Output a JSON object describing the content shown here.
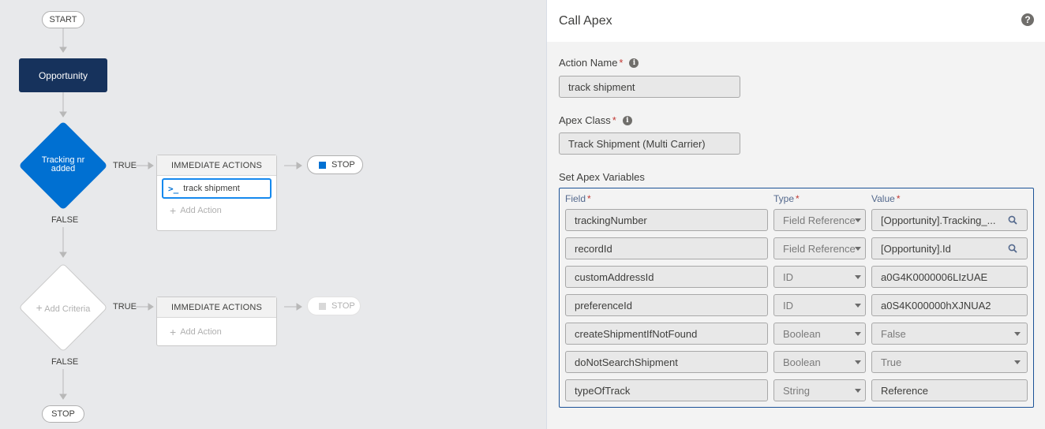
{
  "canvas": {
    "start_label": "START",
    "object_label": "Opportunity",
    "criteria_label": "Tracking nr added",
    "true_label": "TRUE",
    "false_label": "FALSE",
    "immediate_actions_label": "IMMEDIATE ACTIONS",
    "action_item_label": "track shipment",
    "add_action_label": "Add Action",
    "stop_label": "STOP",
    "add_criteria_label": "Add Criteria",
    "end_stop_label": "STOP"
  },
  "panel": {
    "title": "Call Apex",
    "action_name_label": "Action Name",
    "action_name_value": "track shipment",
    "apex_class_label": "Apex Class",
    "apex_class_value": "Track Shipment (Multi Carrier)",
    "set_vars_label": "Set Apex Variables",
    "columns": {
      "field": "Field",
      "type": "Type",
      "value": "Value"
    },
    "rows": [
      {
        "field": "trackingNumber",
        "type": "Field Reference",
        "value": "[Opportunity].Tracking_...",
        "value_kind": "lookup"
      },
      {
        "field": "recordId",
        "type": "Field Reference",
        "value": "[Opportunity].Id",
        "value_kind": "lookup"
      },
      {
        "field": "customAddressId",
        "type": "ID",
        "value": "a0G4K0000006LIzUAE",
        "value_kind": "text"
      },
      {
        "field": "preferenceId",
        "type": "ID",
        "value": "a0S4K000000hXJNUA2",
        "value_kind": "text"
      },
      {
        "field": "createShipmentIfNotFound",
        "type": "Boolean",
        "value": "False",
        "value_kind": "select"
      },
      {
        "field": "doNotSearchShipment",
        "type": "Boolean",
        "value": "True",
        "value_kind": "select"
      },
      {
        "field": "typeOfTrack",
        "type": "String",
        "value": "Reference",
        "value_kind": "text"
      }
    ]
  },
  "colors": {
    "accent": "#0070d2",
    "object_box": "#16325c",
    "required": "#c23934",
    "focus_border": "#1589ee"
  }
}
